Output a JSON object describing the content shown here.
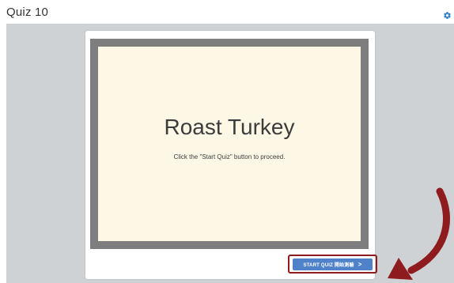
{
  "header": {
    "title": "Quiz 10",
    "settings_icon": "gear-icon"
  },
  "slide": {
    "title": "Roast Turkey",
    "subtitle": "Click the \"Start Quiz\" button to proceed."
  },
  "start_button": {
    "label": "START QUIZ 開始測驗",
    "icon": "chevron-right-icon"
  },
  "colors": {
    "stage_background": "#cfd2d5",
    "slide_frame": "#7e7e7e",
    "slide_background": "#fdf7e6",
    "button": "#4f82c9",
    "highlight": "#8e1b1e",
    "gear": "#2f7fcf"
  }
}
